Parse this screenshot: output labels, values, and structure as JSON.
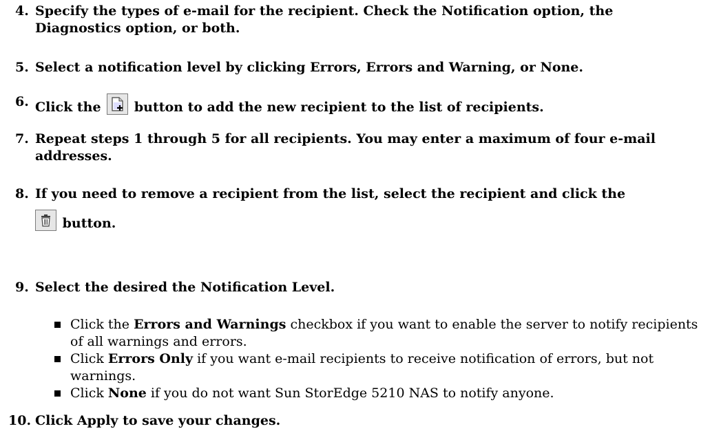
{
  "steps": [
    {
      "num": "4.",
      "text": "Specify the types of e-mail for the recipient. Check the Notification option, the Diagnostics option, or both."
    },
    {
      "num": "5.",
      "text": "Select a notification level by clicking Errors, Errors and Warning, or None."
    },
    {
      "num": "6.",
      "before": "Click the",
      "after": "button to add the new recipient to the list of recipients.",
      "icon": "add-recipient-icon"
    },
    {
      "num": "7.",
      "text": "Repeat steps 1 through 5 for all recipients. You may enter a maximum of four e-mail addresses."
    },
    {
      "num": "8.",
      "text": "If you need to remove a recipient from the list, select the recipient and click the",
      "after": "button.",
      "icon": "trash-icon"
    },
    {
      "num": "9.",
      "text": "Select the desired the Notification Level."
    },
    {
      "num": "10.",
      "text": "Click Apply to save your changes."
    }
  ],
  "bullets": [
    {
      "pre": "Click the",
      "bold": "Errors and Warnings",
      "post": "checkbox if you want to enable the server to notify recipients of all warnings and errors."
    },
    {
      "pre": "Click",
      "bold": "Errors Only",
      "post": "if you want e-mail recipients to receive notification of errors, but not warnings."
    },
    {
      "pre": "Click",
      "bold": "None",
      "post": "if you do not want Sun StorEdge 5210 NAS to notify anyone."
    }
  ]
}
